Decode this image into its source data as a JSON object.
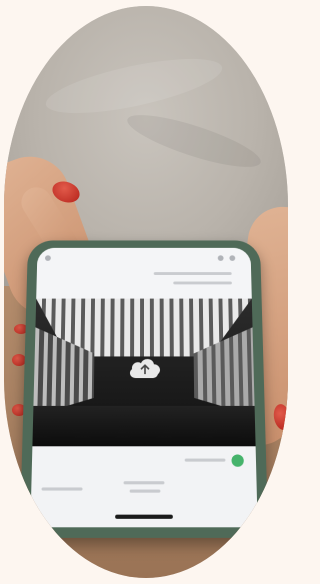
{
  "scene": {
    "subject": "",
    "colors": {
      "background": "#fdf6f0",
      "phone_case": "#4f6a58",
      "nail_polish": "#c82a1e"
    }
  },
  "phone_screen": {
    "icon": "cloud-upload-icon"
  }
}
